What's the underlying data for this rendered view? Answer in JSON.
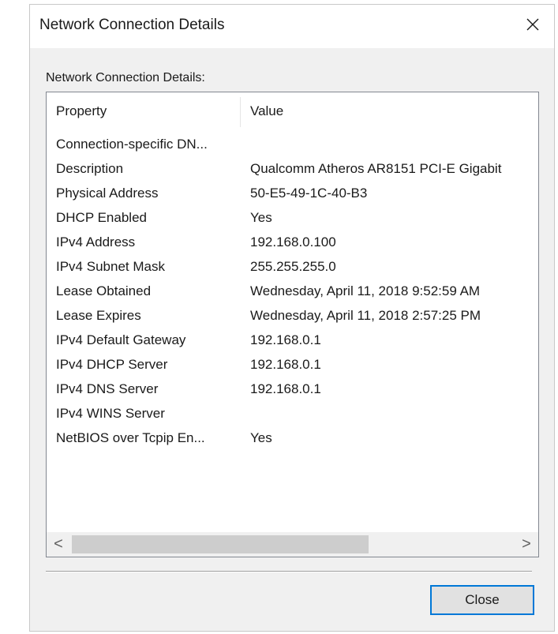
{
  "window": {
    "title": "Network Connection Details",
    "close_icon": "close-x-icon"
  },
  "group_label": "Network Connection Details:",
  "list": {
    "columns": [
      "Property",
      "Value"
    ],
    "rows": [
      {
        "property": "Connection-specific DN...",
        "value": ""
      },
      {
        "property": "Description",
        "value": "Qualcomm Atheros AR8151 PCI-E Gigabit"
      },
      {
        "property": "Physical Address",
        "value": "50-E5-49-1C-40-B3"
      },
      {
        "property": "DHCP Enabled",
        "value": "Yes"
      },
      {
        "property": "IPv4 Address",
        "value": "192.168.0.100"
      },
      {
        "property": "IPv4 Subnet Mask",
        "value": "255.255.255.0"
      },
      {
        "property": "Lease Obtained",
        "value": "Wednesday, April 11, 2018 9:52:59 AM"
      },
      {
        "property": "Lease Expires",
        "value": "Wednesday, April 11, 2018 2:57:25 PM"
      },
      {
        "property": "IPv4 Default Gateway",
        "value": "192.168.0.1"
      },
      {
        "property": "IPv4 DHCP Server",
        "value": "192.168.0.1"
      },
      {
        "property": "IPv4 DNS Server",
        "value": "192.168.0.1"
      },
      {
        "property": "IPv4 WINS Server",
        "value": ""
      },
      {
        "property": "NetBIOS over Tcpip En...",
        "value": "Yes"
      }
    ],
    "scroll_left_glyph": "<",
    "scroll_right_glyph": ">"
  },
  "buttons": {
    "close_label": "Close"
  },
  "colors": {
    "accent": "#0078d7",
    "dialog_bg": "#f0f0f0"
  }
}
